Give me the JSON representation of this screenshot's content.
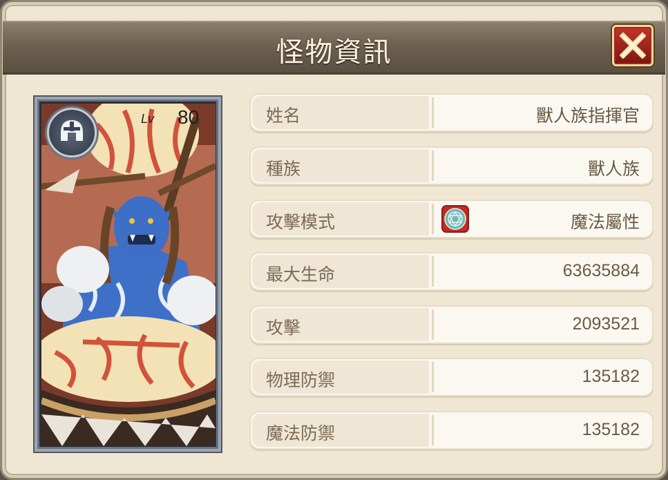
{
  "window": {
    "title": "怪物資訊",
    "close_label": "X"
  },
  "card": {
    "level_label": "Lv",
    "level_value": "80",
    "class_icon": "helmet-icon",
    "portrait": "blue-orc-drummer"
  },
  "stats": [
    {
      "label": "姓名",
      "value": "獸人族指揮官"
    },
    {
      "label": "種族",
      "value": "獸人族"
    },
    {
      "label": "攻擊模式",
      "value": "魔法屬性",
      "icon": "magic-circle-icon"
    },
    {
      "label": "最大生命",
      "value": "63635884"
    },
    {
      "label": "攻擊",
      "value": "2093521"
    },
    {
      "label": "物理防禦",
      "value": "135182"
    },
    {
      "label": "魔法防禦",
      "value": "135182"
    }
  ],
  "colors": {
    "panel": "#efe7d3",
    "titlebar": "#6e6151",
    "close_button": "#b0261f",
    "label_text": "#7b6b56",
    "value_text": "#6a5a46"
  }
}
